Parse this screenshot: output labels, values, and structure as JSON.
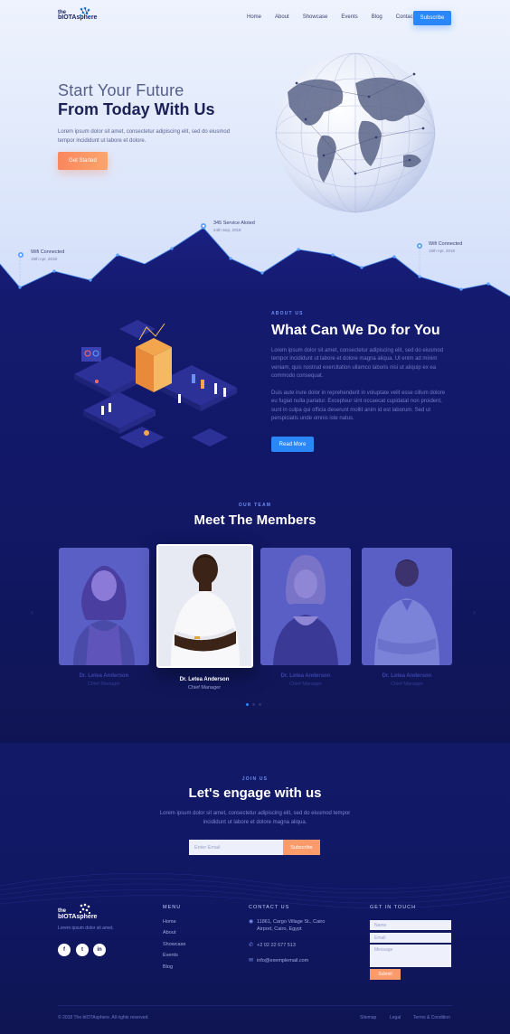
{
  "brand": {
    "line1": "the",
    "line2": "bIOTAsphere"
  },
  "nav": {
    "items": [
      "Home",
      "About",
      "Showcase",
      "Events",
      "Blog",
      "Contact"
    ],
    "subscribe": "Subscribe"
  },
  "hero": {
    "title_line1": "Start Your Future",
    "title_line2": "From Today With Us",
    "subtitle": "Lorem ipsum dolor sit amet, consectetur adipiscing elit, sed do eiusmod tempor incididunt ut labore et dolore.",
    "cta": "Get Started",
    "pins": [
      {
        "title": "Wifi Connected",
        "date": "15th Apr, 2018"
      },
      {
        "title": "345 Service Aloted",
        "date": "24th Sep, 2018"
      },
      {
        "title": "Wifi Connected",
        "date": "15th Apr, 2018"
      }
    ]
  },
  "about": {
    "eyebrow": "ABOUT US",
    "title": "What Can We Do for You",
    "p1": "Lorem ipsum dolor sit amet, consectetur adipiscing elit, sed do eiusmod tempor incididunt ut labore et dolore magna aliqua. Ut enim ad minim veniam, quis nostrud exercitation ullamco laboris nisi ut aliquip ex ea commodo consequat.",
    "p2": "Duis aute irure dolor in reprehenderit in voluptate velit esse cillum dolore eu fugiat nulla pariatur. Excepteur sint occaecat cupidatat non proident, sunt in culpa qui officia deserunt mollit anim id est laborum. Sed ut perspiciatis unde omnis iste natus.",
    "button": "Read More"
  },
  "team": {
    "eyebrow": "OUR TEAM",
    "title": "Meet The Members",
    "members": [
      {
        "name": "Dr. Letea Anderson",
        "role": "Chief Manager"
      },
      {
        "name": "Dr. Letea Anderson",
        "role": "Chief Manager"
      },
      {
        "name": "Dr. Letea Anderson",
        "role": "Chief Manager"
      },
      {
        "name": "Dr. Letea Anderson",
        "role": "Chief Manager"
      }
    ],
    "prev": "‹",
    "next": "›"
  },
  "join": {
    "eyebrow": "JOIN US",
    "title": "Let's engage with us",
    "text": "Lorem ipsum dolor sit amet, consectetur adipiscing elit, sed do eiusmod tempor incididunt ut labore et dolore magna aliqua.",
    "placeholder": "Enter Email",
    "button": "Subscribe"
  },
  "footer": {
    "tagline": "Lorem ipsum dolor sit amet.",
    "social": [
      "f",
      "t",
      "in"
    ],
    "menu_heading": "MENU",
    "menu": [
      "Home",
      "About",
      "Showcase",
      "Events",
      "Blog"
    ],
    "contact_heading": "CONTACT US",
    "address_line1": "11861, Cargo Village St., Cairo",
    "address_line2": "Airport, Cairo, Egypt",
    "phone": "+2 02 22 677 513",
    "email": "info@exemplemail.com",
    "touch_heading": "GET IN TOUCH",
    "name_placeholder": "Name",
    "email_placeholder": "Email",
    "message_placeholder": "Message",
    "submit": "Submit",
    "copyright": "© 2018 The bIOTAsphere. All rights reserved.",
    "bottom_links": [
      "Sitemap",
      "Legal",
      "Terms & Condition"
    ]
  },
  "colors": {
    "accent_blue": "#2b86f7",
    "accent_orange": "#f9875e",
    "navy": "#0f1552"
  },
  "icons": [
    "logo-mark-icon",
    "globe-icon",
    "location-pin-icon",
    "phone-icon",
    "mail-icon",
    "facebook-icon",
    "twitter-icon",
    "linkedin-icon"
  ]
}
